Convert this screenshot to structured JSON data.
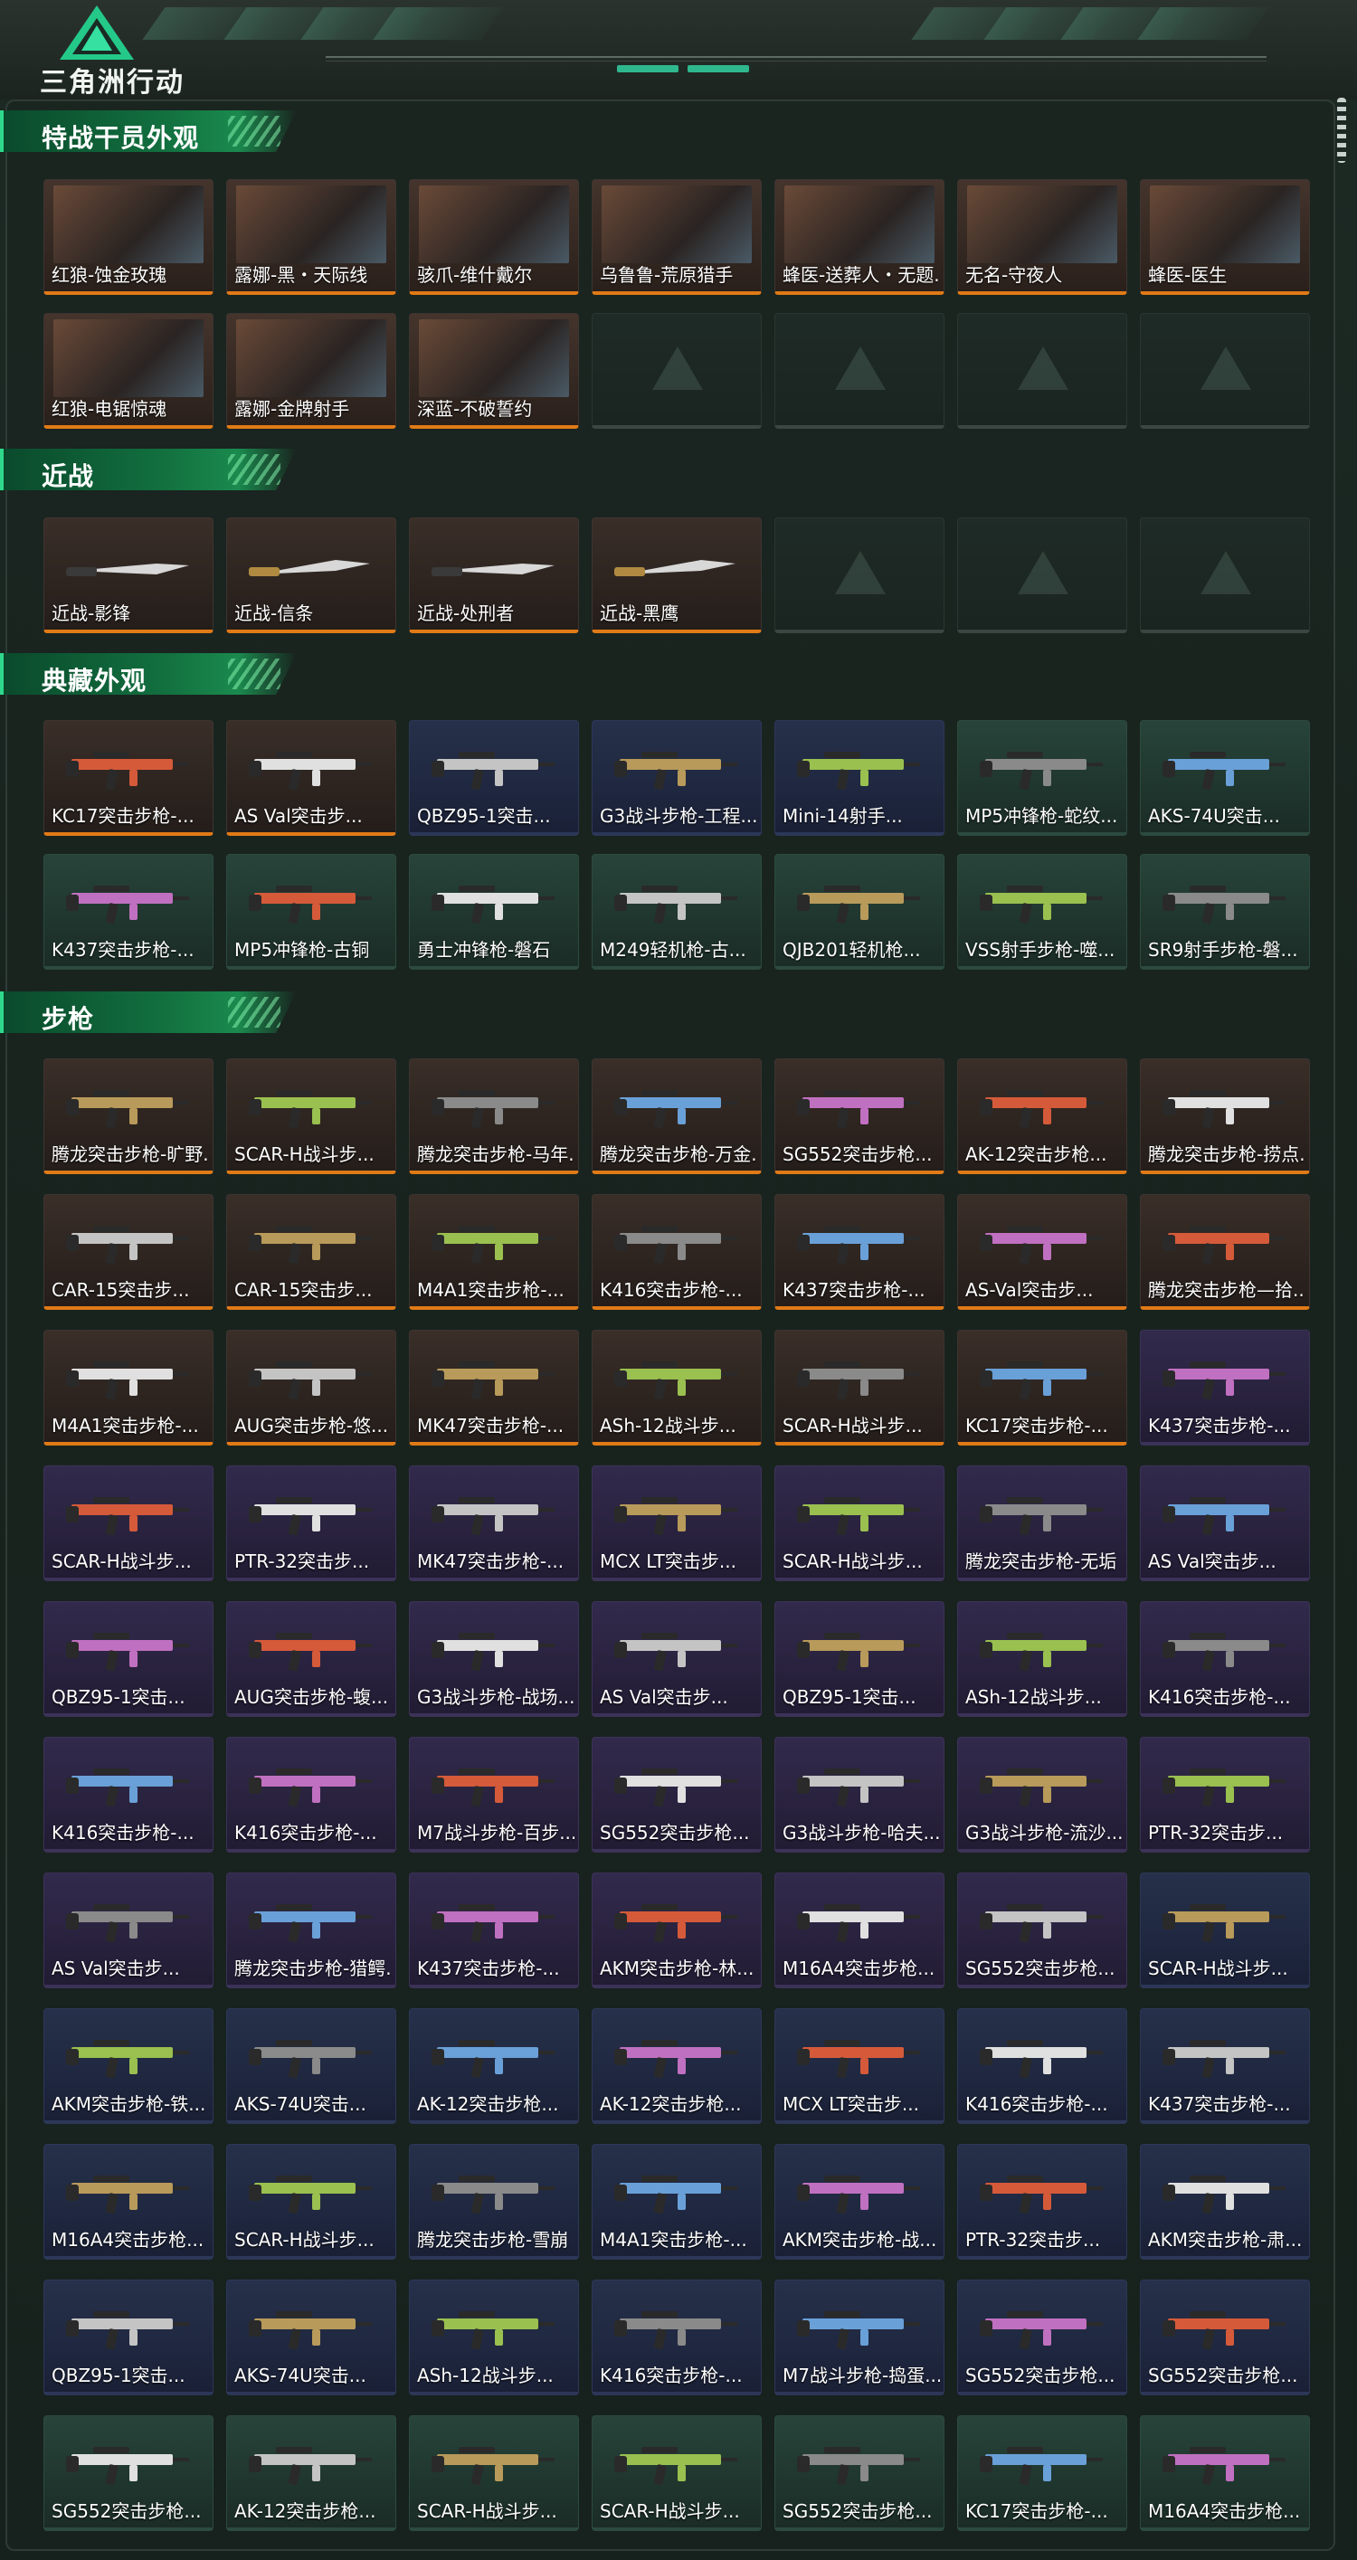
{
  "app": {
    "logo_text": "三角洲行动"
  },
  "colors": {
    "gold": "#e07a16",
    "green": "#2ea86d",
    "blue": "#3a6fe0",
    "purple": "#8a4ae0",
    "accent": "#2fd88b"
  },
  "sections": [
    {
      "title": "特战干员外观",
      "items": [
        {
          "label": "红狼-蚀金玫瑰",
          "rarity": "gold"
        },
        {
          "label": "露娜-黑・天际线",
          "rarity": "gold"
        },
        {
          "label": "骇爪-维什戴尔",
          "rarity": "gold"
        },
        {
          "label": "乌鲁鲁-荒原猎手",
          "rarity": "gold"
        },
        {
          "label": "蜂医-送葬人・无题...",
          "rarity": "gold"
        },
        {
          "label": "无名-守夜人",
          "rarity": "gold"
        },
        {
          "label": "蜂医-医生",
          "rarity": "gold"
        },
        {
          "label": "红狼-电锯惊魂",
          "rarity": "gold"
        },
        {
          "label": "露娜-金牌射手",
          "rarity": "gold"
        },
        {
          "label": "深蓝-不破誓约",
          "rarity": "gold"
        },
        {
          "label": "",
          "rarity": "empty"
        },
        {
          "label": "",
          "rarity": "empty"
        },
        {
          "label": "",
          "rarity": "empty"
        },
        {
          "label": "",
          "rarity": "empty"
        }
      ]
    },
    {
      "title": "近战",
      "items": [
        {
          "label": "近战-影锋",
          "rarity": "gold"
        },
        {
          "label": "近战-信条",
          "rarity": "gold"
        },
        {
          "label": "近战-处刑者",
          "rarity": "gold"
        },
        {
          "label": "近战-黑鹰",
          "rarity": "gold"
        },
        {
          "label": "",
          "rarity": "empty"
        },
        {
          "label": "",
          "rarity": "empty"
        },
        {
          "label": "",
          "rarity": "empty"
        }
      ]
    },
    {
      "title": "典藏外观",
      "items": [
        {
          "label": "KC17突击步枪-...",
          "rarity": "gold"
        },
        {
          "label": "AS Val突击步...",
          "rarity": "gold"
        },
        {
          "label": "QBZ95-1突击...",
          "rarity": "blue"
        },
        {
          "label": "G3战斗步枪-工程...",
          "rarity": "blue"
        },
        {
          "label": "Mini-14射手...",
          "rarity": "blue"
        },
        {
          "label": "MP5冲锋枪-蛇纹...",
          "rarity": "green"
        },
        {
          "label": "AKS-74U突击...",
          "rarity": "green"
        },
        {
          "label": "K437突击步枪-...",
          "rarity": "green"
        },
        {
          "label": "MP5冲锋枪-古铜",
          "rarity": "green"
        },
        {
          "label": "勇士冲锋枪-磐石",
          "rarity": "green"
        },
        {
          "label": "M249轻机枪-古...",
          "rarity": "green"
        },
        {
          "label": "QJB201轻机枪...",
          "rarity": "green"
        },
        {
          "label": "VSS射手步枪-噬...",
          "rarity": "green"
        },
        {
          "label": "SR9射手步枪-磐...",
          "rarity": "green"
        }
      ]
    },
    {
      "title": "步枪",
      "items": [
        {
          "label": "腾龙突击步枪-旷野...",
          "rarity": "gold"
        },
        {
          "label": "SCAR-H战斗步...",
          "rarity": "gold"
        },
        {
          "label": "腾龙突击步枪-马年...",
          "rarity": "gold"
        },
        {
          "label": "腾龙突击步枪-万金...",
          "rarity": "gold"
        },
        {
          "label": "SG552突击步枪...",
          "rarity": "gold"
        },
        {
          "label": "AK-12突击步枪...",
          "rarity": "gold"
        },
        {
          "label": "腾龙突击步枪-捞点...",
          "rarity": "gold"
        },
        {
          "label": "CAR-15突击步...",
          "rarity": "gold"
        },
        {
          "label": "CAR-15突击步...",
          "rarity": "gold"
        },
        {
          "label": "M4A1突击步枪-...",
          "rarity": "gold"
        },
        {
          "label": "K416突击步枪-...",
          "rarity": "gold"
        },
        {
          "label": "K437突击步枪-...",
          "rarity": "gold"
        },
        {
          "label": "AS-Val突击步...",
          "rarity": "gold"
        },
        {
          "label": "腾龙突击步枪—拾...",
          "rarity": "gold"
        },
        {
          "label": "M4A1突击步枪-...",
          "rarity": "gold"
        },
        {
          "label": "AUG突击步枪-悠...",
          "rarity": "gold"
        },
        {
          "label": "MK47突击步枪-...",
          "rarity": "gold"
        },
        {
          "label": "ASh-12战斗步...",
          "rarity": "gold"
        },
        {
          "label": "SCAR-H战斗步...",
          "rarity": "gold"
        },
        {
          "label": "KC17突击步枪-...",
          "rarity": "gold"
        },
        {
          "label": "K437突击步枪-...",
          "rarity": "purple"
        },
        {
          "label": "SCAR-H战斗步...",
          "rarity": "purple"
        },
        {
          "label": "PTR-32突击步...",
          "rarity": "purple"
        },
        {
          "label": "MK47突击步枪-...",
          "rarity": "purple"
        },
        {
          "label": "MCX LT突击步...",
          "rarity": "purple"
        },
        {
          "label": "SCAR-H战斗步...",
          "rarity": "purple"
        },
        {
          "label": "腾龙突击步枪-无垢",
          "rarity": "purple"
        },
        {
          "label": "AS Val突击步...",
          "rarity": "purple"
        },
        {
          "label": "QBZ95-1突击...",
          "rarity": "purple"
        },
        {
          "label": "AUG突击步枪-蝮...",
          "rarity": "purple"
        },
        {
          "label": "G3战斗步枪-战场...",
          "rarity": "purple"
        },
        {
          "label": "AS Val突击步...",
          "rarity": "purple"
        },
        {
          "label": "QBZ95-1突击...",
          "rarity": "purple"
        },
        {
          "label": "ASh-12战斗步...",
          "rarity": "purple"
        },
        {
          "label": "K416突击步枪-...",
          "rarity": "purple"
        },
        {
          "label": "K416突击步枪-...",
          "rarity": "purple"
        },
        {
          "label": "K416突击步枪-...",
          "rarity": "purple"
        },
        {
          "label": "M7战斗步枪-百步...",
          "rarity": "purple"
        },
        {
          "label": "SG552突击步枪...",
          "rarity": "purple"
        },
        {
          "label": "G3战斗步枪-哈夫...",
          "rarity": "purple"
        },
        {
          "label": "G3战斗步枪-流沙...",
          "rarity": "purple"
        },
        {
          "label": "PTR-32突击步...",
          "rarity": "purple"
        },
        {
          "label": "AS Val突击步...",
          "rarity": "purple"
        },
        {
          "label": "腾龙突击步枪-猎鳄...",
          "rarity": "purple"
        },
        {
          "label": "K437突击步枪-...",
          "rarity": "purple"
        },
        {
          "label": "AKM突击步枪-林...",
          "rarity": "purple"
        },
        {
          "label": "M16A4突击步枪...",
          "rarity": "purple"
        },
        {
          "label": "SG552突击步枪...",
          "rarity": "purple"
        },
        {
          "label": "SCAR-H战斗步...",
          "rarity": "blue"
        },
        {
          "label": "AKM突击步枪-铁...",
          "rarity": "blue"
        },
        {
          "label": "AKS-74U突击...",
          "rarity": "blue"
        },
        {
          "label": "AK-12突击步枪...",
          "rarity": "blue"
        },
        {
          "label": "AK-12突击步枪...",
          "rarity": "blue"
        },
        {
          "label": "MCX LT突击步...",
          "rarity": "blue"
        },
        {
          "label": "K416突击步枪-...",
          "rarity": "blue"
        },
        {
          "label": "K437突击步枪-...",
          "rarity": "blue"
        },
        {
          "label": "M16A4突击步枪...",
          "rarity": "blue"
        },
        {
          "label": "SCAR-H战斗步...",
          "rarity": "blue"
        },
        {
          "label": "腾龙突击步枪-雪崩",
          "rarity": "blue"
        },
        {
          "label": "M4A1突击步枪-...",
          "rarity": "blue"
        },
        {
          "label": "AKM突击步枪-战...",
          "rarity": "blue"
        },
        {
          "label": "PTR-32突击步...",
          "rarity": "blue"
        },
        {
          "label": "AKM突击步枪-肃...",
          "rarity": "blue"
        },
        {
          "label": "QBZ95-1突击...",
          "rarity": "blue"
        },
        {
          "label": "AKS-74U突击...",
          "rarity": "blue"
        },
        {
          "label": "ASh-12战斗步...",
          "rarity": "blue"
        },
        {
          "label": "K416突击步枪-...",
          "rarity": "blue"
        },
        {
          "label": "M7战斗步枪-捣蛋...",
          "rarity": "blue"
        },
        {
          "label": "SG552突击步枪...",
          "rarity": "blue"
        },
        {
          "label": "SG552突击步枪...",
          "rarity": "blue"
        },
        {
          "label": "SG552突击步枪...",
          "rarity": "green"
        },
        {
          "label": "AK-12突击步枪...",
          "rarity": "green"
        },
        {
          "label": "SCAR-H战斗步...",
          "rarity": "green"
        },
        {
          "label": "SCAR-H战斗步...",
          "rarity": "green"
        },
        {
          "label": "SG552突击步枪...",
          "rarity": "green"
        },
        {
          "label": "KC17突击步枪-...",
          "rarity": "green"
        },
        {
          "label": "M16A4突击步枪...",
          "rarity": "green"
        }
      ]
    }
  ]
}
